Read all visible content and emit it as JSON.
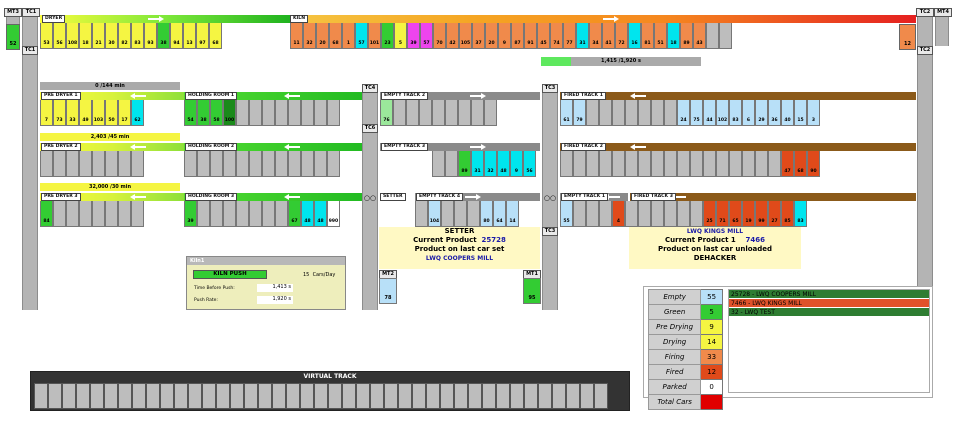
{
  "posts": [
    "MT3",
    "TC1",
    "TC1",
    "TC4",
    "TC6",
    "TC3",
    "TC3",
    "TC3",
    "TC2",
    "MT4",
    "TC2",
    "MT2",
    "MT1"
  ],
  "top": {
    "dryer_label": "DRYER",
    "kiln_label": "KILN",
    "mt3_value": "52",
    "mt4_value": "12",
    "dryer_cells": [
      "53",
      "56",
      "108",
      "18",
      "21",
      "30",
      "82",
      "83",
      "93",
      "38",
      "94",
      "13",
      "97",
      "68"
    ],
    "dryer_colors": [
      "y",
      "y",
      "y",
      "y",
      "y",
      "y",
      "y",
      "y",
      "y",
      "g",
      "y",
      "y",
      "y",
      "y"
    ],
    "kiln_cells": [
      "11",
      "32",
      "20",
      "68",
      "1",
      "57",
      "101",
      "23",
      "5",
      "39",
      "57",
      "70",
      "42",
      "105",
      "37",
      "20",
      "9",
      "87",
      "91",
      "45",
      "74",
      "77",
      "31",
      "34",
      "41",
      "72",
      "16",
      "81",
      "51",
      "18",
      "89",
      "43",
      "",
      ""
    ],
    "kiln_colors": [
      "o",
      "o",
      "o",
      "o",
      "o",
      "c",
      "o",
      "g",
      "y",
      "m",
      "m",
      "o",
      "o",
      "o",
      "o",
      "o",
      "o",
      "o",
      "o",
      "o",
      "o",
      "o",
      "c",
      "o",
      "o",
      "o",
      "c",
      "o",
      "o",
      "c",
      "o",
      "o",
      "gr",
      "gr"
    ]
  },
  "progress": {
    "label": "1,415 /1,920 s",
    "fill": 0.19
  },
  "rows": [
    {
      "pre_label": "PRE DRYER 1",
      "hold_label": "HOLDING ROOM 1",
      "counter": "0 /144 min",
      "pre_cells": [
        "7",
        "73",
        "33",
        "49",
        "103",
        "50",
        "17",
        "62"
      ],
      "pre_colors": [
        "y",
        "y",
        "y",
        "y",
        "y",
        "y",
        "y",
        "c"
      ],
      "hold_cells": [
        "54",
        "38",
        "58",
        "100"
      ],
      "hold_colors": [
        "g",
        "g",
        "g",
        "dg"
      ],
      "mid_cells": [
        "",
        "",
        "",
        "",
        "",
        "",
        "",
        ""
      ],
      "mid_colors": [
        "gr",
        "gr",
        "gr",
        "gr",
        "gr",
        "gr",
        "gr",
        "gr"
      ]
    },
    {
      "pre_label": "PRE DRYER 2",
      "hold_label": "HOLDING ROOM 2",
      "counter": "2,403 /45 min",
      "pre_cells": [
        "",
        "",
        "",
        "",
        "",
        "",
        "",
        ""
      ],
      "pre_colors": [
        "gr",
        "gr",
        "gr",
        "gr",
        "gr",
        "gr",
        "gr",
        "gr"
      ],
      "hold_cells": [
        "",
        "",
        "",
        ""
      ],
      "hold_colors": [
        "gr",
        "gr",
        "gr",
        "gr"
      ],
      "mid_cells": [
        "",
        "",
        "",
        "",
        "",
        "",
        "",
        ""
      ],
      "mid_colors": [
        "gr",
        "gr",
        "gr",
        "gr",
        "gr",
        "gr",
        "gr",
        "gr"
      ]
    },
    {
      "pre_label": "PRE DRYER 3",
      "hold_label": "HOLDING ROOM 3",
      "counter": "32,000 /30 min",
      "pre_cells": [
        "84",
        "",
        "",
        "",
        "",
        "",
        "",
        ""
      ],
      "pre_colors": [
        "g",
        "gr",
        "gr",
        "gr",
        "gr",
        "gr",
        "gr",
        "gr"
      ],
      "hold_cells": [
        "39",
        "",
        "",
        ""
      ],
      "hold_colors": [
        "g",
        "gr",
        "gr",
        "gr"
      ],
      "mid_cells": [
        "",
        "",
        "",
        "",
        "67",
        "48",
        "48",
        "990"
      ],
      "mid_colors": [
        "gr",
        "gr",
        "gr",
        "gr",
        "g",
        "c",
        "c",
        "w"
      ]
    }
  ],
  "empty_tracks": [
    {
      "label": "EMPTY TRACK 2",
      "cells": [
        "76",
        "",
        "",
        "",
        "",
        "",
        "",
        "",
        ""
      ],
      "colors": [
        "lg",
        "gr",
        "gr",
        "gr",
        "gr",
        "gr",
        "gr",
        "gr",
        "gr"
      ]
    },
    {
      "label": "EMPTY TRACK 3",
      "cells": [
        "",
        "",
        "89",
        "31",
        "32",
        "48",
        "9",
        "56"
      ],
      "colors": [
        "gr",
        "gr",
        "g",
        "c",
        "c",
        "c",
        "c",
        "c"
      ]
    },
    {
      "label": "EMPTY TRACK 4",
      "setter_label": "SETTER",
      "cells": [
        "",
        "104",
        "",
        "",
        "",
        "80",
        "64",
        "14"
      ],
      "colors": [
        "gr",
        "lb",
        "gr",
        "gr",
        "gr",
        "lb",
        "lb",
        "lb"
      ]
    }
  ],
  "fired_tracks": [
    {
      "label": "FIRED TRACK 1",
      "cells": [
        "61",
        "79",
        "",
        "",
        "",
        "",
        "",
        "",
        "",
        "24",
        "75",
        "44",
        "102",
        "83",
        "6",
        "29",
        "36",
        "40",
        "15",
        "3"
      ],
      "colors": [
        "lb",
        "lb",
        "gr",
        "gr",
        "gr",
        "gr",
        "gr",
        "gr",
        "gr",
        "lb",
        "lb",
        "lb",
        "lb",
        "lb",
        "lb",
        "lb",
        "lb",
        "lb",
        "lb",
        "lb"
      ]
    },
    {
      "label": "FIRED TRACK 2",
      "cells": [
        "",
        "",
        "",
        "",
        "",
        "",
        "",
        "",
        "",
        "",
        "",
        "",
        "",
        "",
        "",
        "",
        "",
        "47",
        "68",
        "90"
      ],
      "colors": [
        "gr",
        "gr",
        "gr",
        "gr",
        "gr",
        "gr",
        "gr",
        "gr",
        "gr",
        "gr",
        "gr",
        "gr",
        "gr",
        "gr",
        "gr",
        "gr",
        "gr",
        "r",
        "r",
        "r"
      ]
    },
    {
      "label": "FIRED TRACK 3",
      "empty_label": "EMPTY TRACK 1",
      "cells": [
        "55",
        "",
        "",
        "",
        "4",
        "",
        "",
        "",
        "",
        "",
        "",
        "25",
        "71",
        "65",
        "19",
        "99",
        "27",
        "85",
        "83"
      ],
      "colors": [
        "lb",
        "gr",
        "gr",
        "gr",
        "r",
        "gr",
        "gr",
        "gr",
        "gr",
        "gr",
        "gr",
        "r",
        "r",
        "r",
        "r",
        "r",
        "r",
        "r",
        "c"
      ]
    }
  ],
  "setter": {
    "title": "SETTER",
    "product_label": "Current Product",
    "product_value": "25728",
    "sub": "Product on last car set",
    "mill": "LWQ COOPERS MILL"
  },
  "dehacker": {
    "mill_top": "LWQ KINGS MILL",
    "product_label": "Current Product 1",
    "product_value": "7466",
    "sub": "Product on last car unloaded",
    "title": "DEHACKER"
  },
  "mt2_value": "78",
  "mt1_value": "95",
  "kiln_panel": {
    "title": "Kiln1",
    "push_label": "KILN PUSH",
    "cars_value": "15",
    "cars_unit": "Cars/Day",
    "before_label": "Time Before Push:",
    "before_value": "1,413",
    "before_unit": "s",
    "rate_label": "Push Rate:",
    "rate_value": "1,920",
    "rate_unit": "s"
  },
  "virtual_track": {
    "title": "VIRTUAL TRACK"
  },
  "legend": [
    {
      "label": "Empty",
      "value": "55",
      "color": "#b8e0f8"
    },
    {
      "label": "Green",
      "value": "5",
      "color": "#33cc33"
    },
    {
      "label": "Pre Drying",
      "value": "9",
      "color": "#f5f542"
    },
    {
      "label": "Drying",
      "value": "14",
      "color": "#f5f542"
    },
    {
      "label": "Firing",
      "value": "33",
      "color": "#f08a4b"
    },
    {
      "label": "Fired",
      "value": "12",
      "color": "#e04a1a"
    },
    {
      "label": "Parked",
      "value": "0",
      "color": "#ffffff"
    },
    {
      "label": "Total Cars",
      "value": "",
      "color": "#e00000"
    }
  ],
  "products": [
    {
      "text": "25728 - LWQ COOPERS MILL",
      "color": "#2e7d32"
    },
    {
      "text": "7466 - LWQ KINGS MILL",
      "color": "#e0522a"
    },
    {
      "text": "32 - LWQ TEST",
      "color": "#2e7d32"
    }
  ],
  "colors": {
    "y": "#f5f542",
    "g": "#33cc33",
    "dg": "#1a8a1a",
    "lg": "#9be89b",
    "c": "#00e5ee",
    "o": "#f08a4b",
    "m": "#ee44ee",
    "r": "#e04a1a",
    "lb": "#b8e0f8",
    "gr": "#bdbdbd",
    "w": "#ffffff"
  }
}
